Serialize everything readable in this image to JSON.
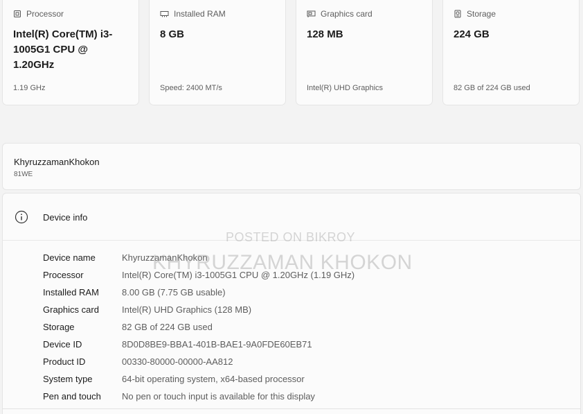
{
  "spec_cards": [
    {
      "title": "Processor",
      "icon": "processor-icon",
      "value": "Intel(R) Core(TM) i3-1005G1 CPU @ 1.20GHz",
      "sub": "1.19 GHz"
    },
    {
      "title": "Installed RAM",
      "icon": "ram-icon",
      "value": "8 GB",
      "sub": "Speed: 2400 MT/s"
    },
    {
      "title": "Graphics card",
      "icon": "graphics-card-icon",
      "value": "128 MB",
      "sub": "Intel(R) UHD Graphics"
    },
    {
      "title": "Storage",
      "icon": "storage-icon",
      "value": "224 GB",
      "sub": "82 GB of 224 GB used"
    }
  ],
  "device": {
    "name": "KhyruzzamanKhokon",
    "model": "81WE"
  },
  "device_info": {
    "title": "Device info",
    "icon": "info-icon",
    "rows": [
      {
        "label": "Device name",
        "value": "KhyruzzamanKhokon"
      },
      {
        "label": "Processor",
        "value": "Intel(R) Core(TM) i3-1005G1 CPU @ 1.20GHz (1.19 GHz)"
      },
      {
        "label": "Installed RAM",
        "value": "8.00 GB (7.75 GB usable)"
      },
      {
        "label": "Graphics card",
        "value": "Intel(R) UHD Graphics (128 MB)"
      },
      {
        "label": "Storage",
        "value": "82 GB of 224 GB used"
      },
      {
        "label": "Device ID",
        "value": "8D0D8BE9-BBA1-401B-BAE1-9A0FDE60EB71"
      },
      {
        "label": "Product ID",
        "value": "00330-80000-00000-AA812"
      },
      {
        "label": "System type",
        "value": "64-bit operating system, x64-based processor"
      },
      {
        "label": "Pen and touch",
        "value": "No pen or touch input is available for this display"
      }
    ]
  },
  "watermark": {
    "line1": "POSTED ON BIKROY",
    "line2": "KHYRUZZAMAN KHOKON"
  }
}
